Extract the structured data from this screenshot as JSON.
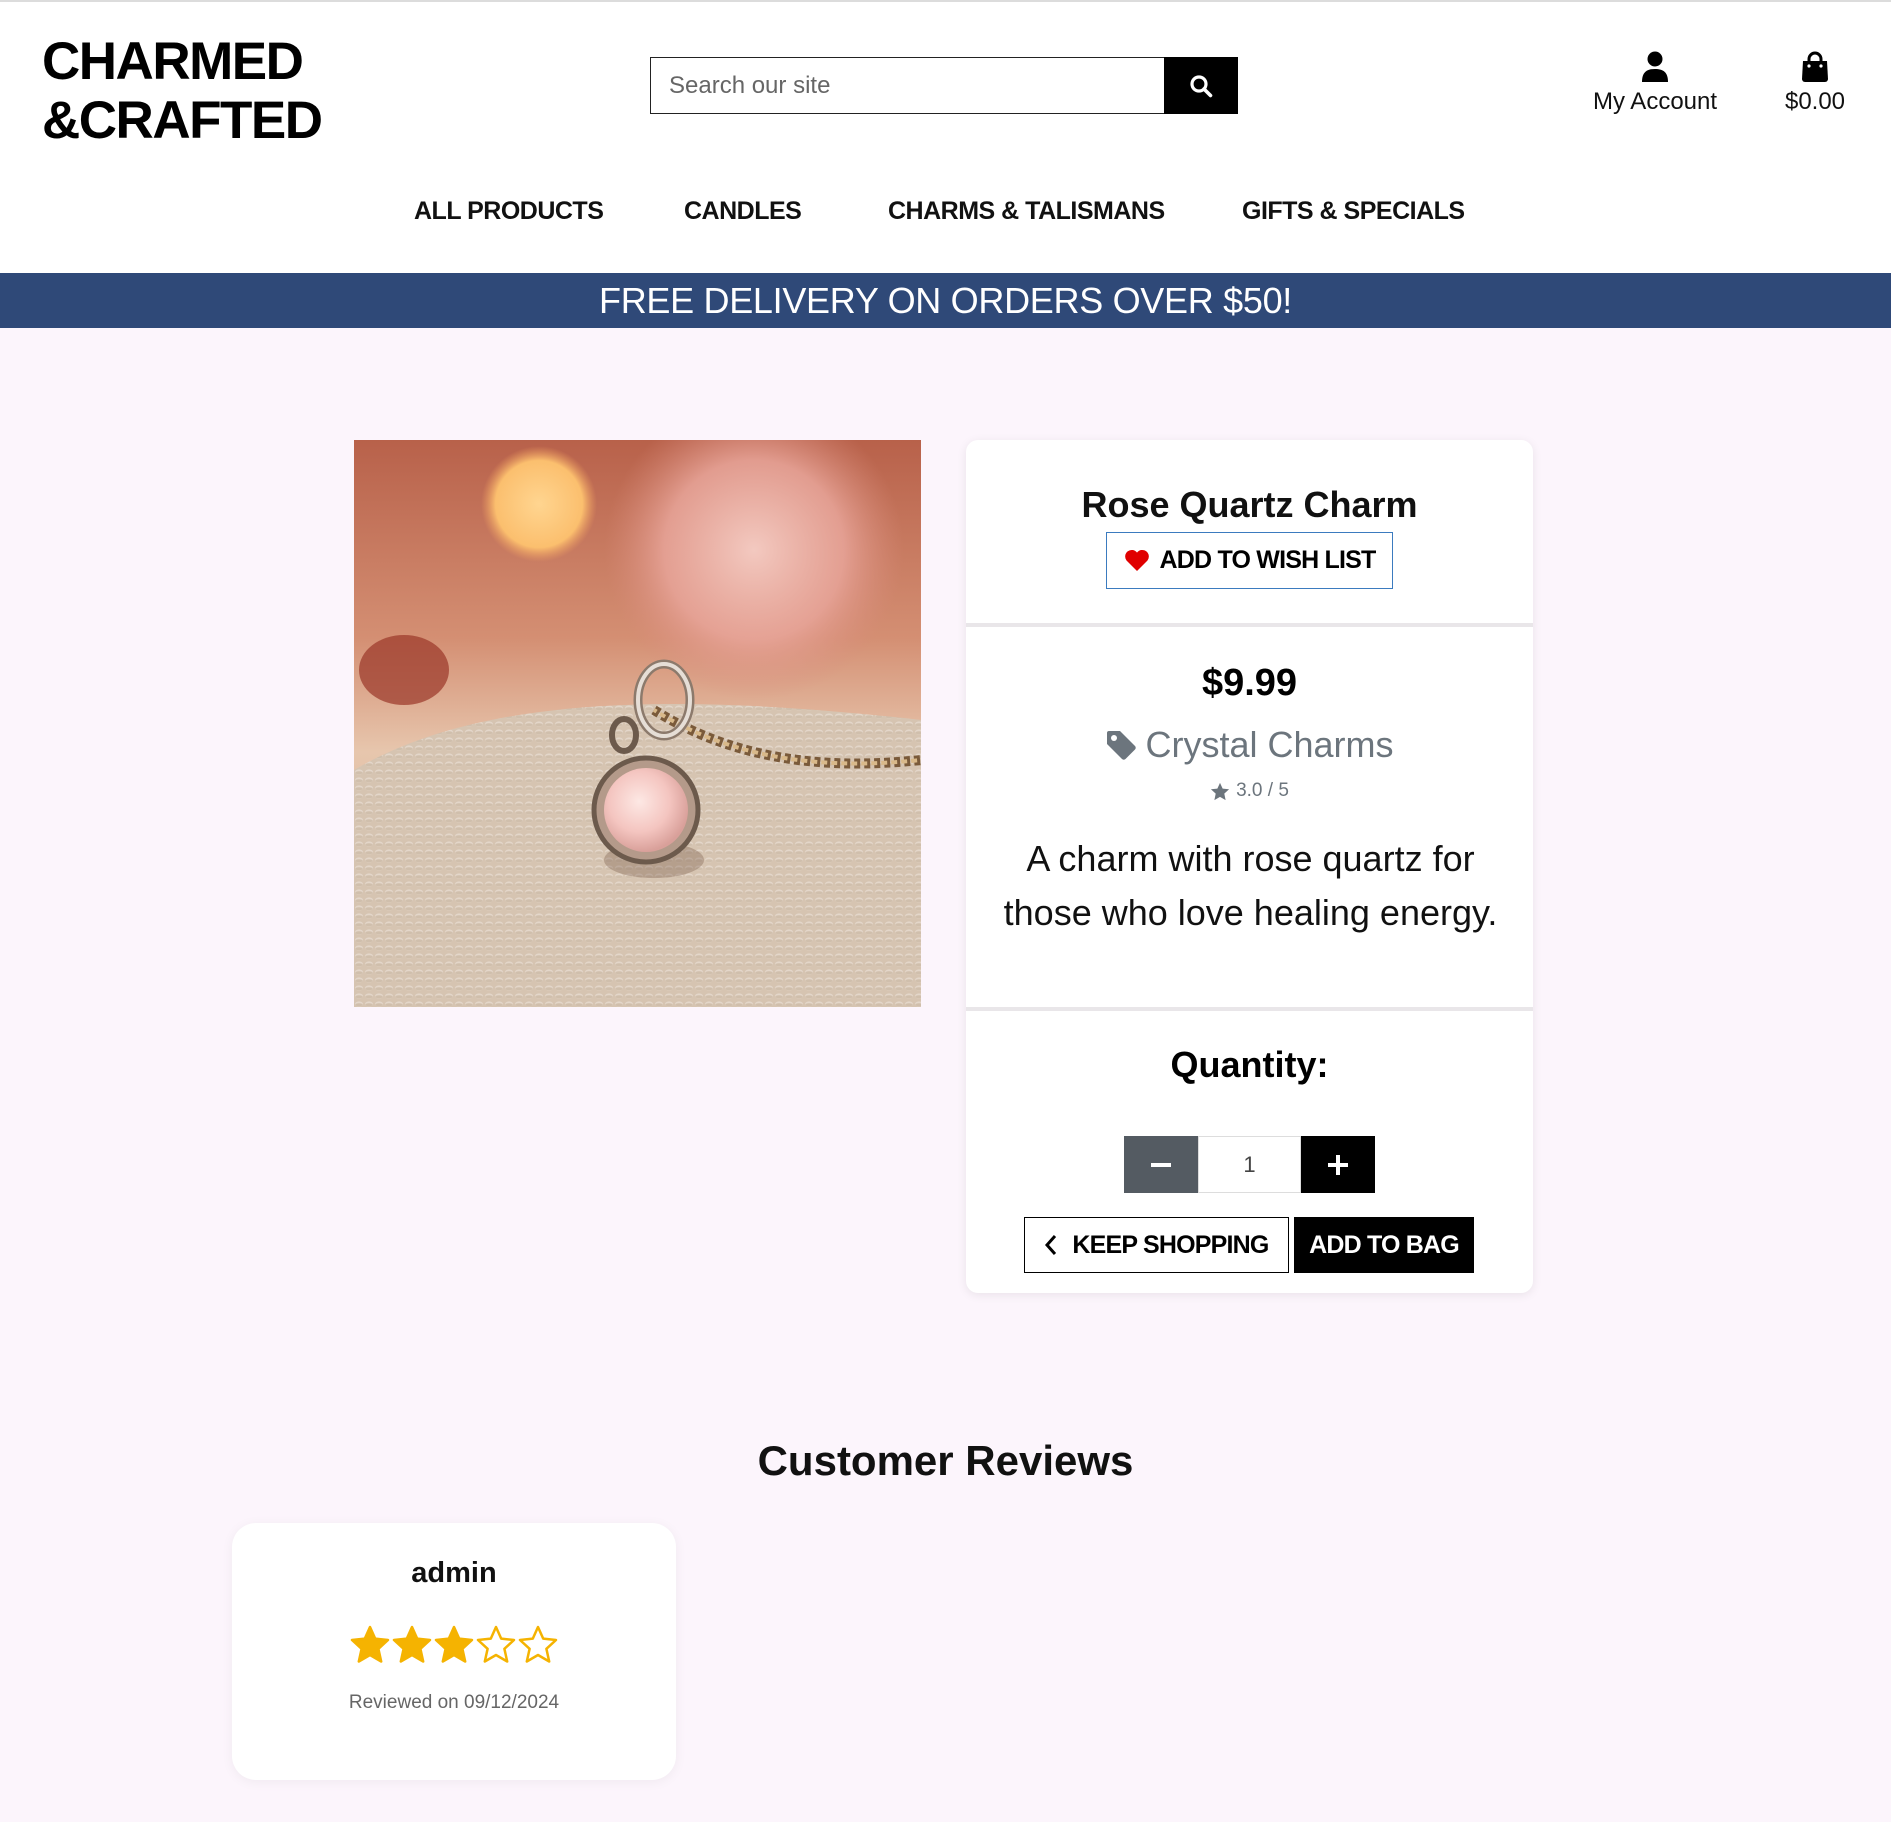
{
  "header": {
    "logo_line1": "CHARMED",
    "logo_line2": "&CRAFTED",
    "search_placeholder": "Search our site",
    "account_label": "My Account",
    "bag_total": "$0.00",
    "icons": {
      "search": "search-icon",
      "account": "user-icon",
      "bag": "shopping-bag-icon"
    }
  },
  "nav": {
    "items": [
      {
        "label": "ALL PRODUCTS"
      },
      {
        "label": "CANDLES"
      },
      {
        "label": "CHARMS & TALISMANS"
      },
      {
        "label": "GIFTS & SPECIALS"
      }
    ]
  },
  "banner": {
    "text": "FREE DELIVERY ON ORDERS OVER $50!",
    "color": "#2f4978"
  },
  "product": {
    "title": "Rose Quartz Charm",
    "wishlist_label": "ADD TO WISH LIST",
    "price": "$9.99",
    "category": "Crystal Charms",
    "rating": "3.0 / 5",
    "description": "A charm with rose quartz for those who love healing energy.",
    "quantity_label": "Quantity:",
    "quantity_value": "1",
    "keep_shopping_label": "KEEP SHOPPING",
    "add_to_bag_label": "ADD TO BAG",
    "icons": {
      "wishlist": "heart-icon",
      "category": "tag-icon",
      "rating": "star-icon",
      "decrement": "minus-icon",
      "increment": "plus-icon",
      "back": "chevron-left-icon"
    }
  },
  "reviews": {
    "title": "Customer Reviews",
    "items": [
      {
        "author": "admin",
        "rating": 3,
        "max_rating": 5,
        "date": "Reviewed on 09/12/2024"
      }
    ]
  },
  "colors": {
    "accent_heart": "#e00000",
    "star_gold": "#f5b301",
    "page_background": "#fcf5fc"
  }
}
